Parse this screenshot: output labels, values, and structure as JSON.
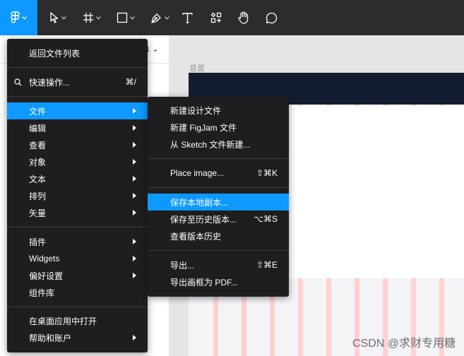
{
  "left_panel": {
    "page_fragment": "1 ⌄"
  },
  "canvas": {
    "frame_label": "总览"
  },
  "main_menu": {
    "items": [
      {
        "label": "返回文件列表"
      },
      {
        "label": "快速操作...",
        "shortcut": "⌘/"
      },
      {
        "label": "文件",
        "submenu": true,
        "active": true
      },
      {
        "label": "编辑",
        "submenu": true
      },
      {
        "label": "查看",
        "submenu": true
      },
      {
        "label": "对象",
        "submenu": true
      },
      {
        "label": "文本",
        "submenu": true
      },
      {
        "label": "排列",
        "submenu": true
      },
      {
        "label": "矢量",
        "submenu": true
      },
      {
        "label": "插件",
        "submenu": true
      },
      {
        "label": "Widgets",
        "submenu": true
      },
      {
        "label": "偏好设置",
        "submenu": true
      },
      {
        "label": "组件库"
      },
      {
        "label": "在桌面应用中打开"
      },
      {
        "label": "帮助和账户",
        "submenu": true
      }
    ]
  },
  "file_submenu": {
    "items": [
      {
        "label": "新建设计文件"
      },
      {
        "label": "新建 FigJam 文件"
      },
      {
        "label": "从 Sketch 文件新建..."
      },
      {
        "label": "Place image...",
        "shortcut": "⇧⌘K"
      },
      {
        "label": "保存本地副本...",
        "active": true
      },
      {
        "label": "保存至历史版本...",
        "shortcut": "⌥⌘S"
      },
      {
        "label": "查看版本历史"
      },
      {
        "label": "导出...",
        "shortcut": "⇧⌘E"
      },
      {
        "label": "导出画框为 PDF..."
      }
    ]
  },
  "watermark": "CSDN @求财专用糖",
  "colors": {
    "accent": "#0d99ff",
    "menu_bg": "#1e1e1e",
    "toolbar_bg": "#2c2c2c"
  }
}
